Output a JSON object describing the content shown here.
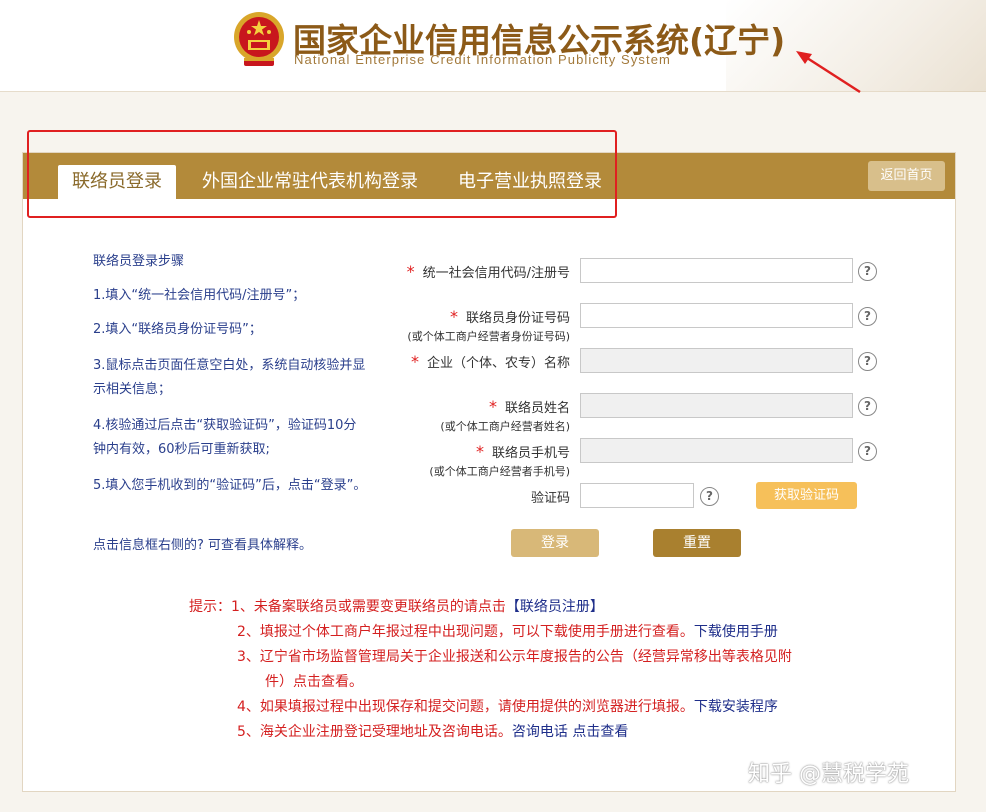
{
  "header": {
    "title": "国家企业信用信息公示系统(辽宁)",
    "subtitle": "National Enterprise Credit Information Publicity System"
  },
  "tabs": [
    {
      "label": "联络员登录",
      "active": true
    },
    {
      "label": "外国企业常驻代表机构登录",
      "active": false
    },
    {
      "label": "电子营业执照登录",
      "active": false
    }
  ],
  "back_home_label": "返回首页",
  "steps": {
    "title": "联络员登录步骤",
    "items": [
      "1.填入“统一社会信用代码/注册号”；",
      "2.填入“联络员身份证号码”；",
      "3.鼠标点击页面任意空白处，系统自动核验并显示相关信息；",
      "4.核验通过后点击“获取验证码”，验证码10分钟内有效，60秒后可重新获取;",
      "5.填入您手机收到的“验证码”后，点击“登录”。"
    ],
    "help_note": "点击信息框右侧的? 可查看具体解释。"
  },
  "form": {
    "required_mark": "*",
    "fields": [
      {
        "label": "统一社会信用代码/注册号",
        "sub": ""
      },
      {
        "label": "联络员身份证号码",
        "sub": "(或个体工商户经营者身份证号码)"
      },
      {
        "label": "企业（个体、农专）名称",
        "sub": ""
      },
      {
        "label": "联络员姓名",
        "sub": "(或个体工商户经营者姓名)"
      },
      {
        "label": "联络员手机号",
        "sub": "(或个体工商户经营者手机号)"
      }
    ],
    "code_label": "验证码",
    "get_code_label": "获取验证码",
    "help_symbol": "?",
    "login_label": "登录",
    "reset_label": "重置"
  },
  "tips": {
    "prefix": "提示：",
    "t1_text": "1、未备案联络员或需要变更联络员的请点击",
    "t1_link": "【联络员注册】",
    "t2_text": "2、填报过个体工商户年报过程中出现问题，可以下载使用手册进行查看。",
    "t2_link": "下载使用手册",
    "t3_line1": "3、辽宁省市场监督管理局关于企业报送和公示年度报告的公告（经营异常移出等表格见附",
    "t3_line2": "件）点击查看。",
    "t4_text": "4、如果填报过程中出现保存和提交问题，请使用提供的浏览器进行填报。",
    "t4_link": "下载安装程序",
    "t5_text": "5、海关企业注册登记受理地址及咨询电话。",
    "t5_link": "咨询电话 点击查看"
  },
  "watermark": "知乎 @慧税学苑",
  "colors": {
    "brand_gold": "#b38a3a",
    "tip_red": "#d42020",
    "link_blue": "#1e2e8a"
  }
}
